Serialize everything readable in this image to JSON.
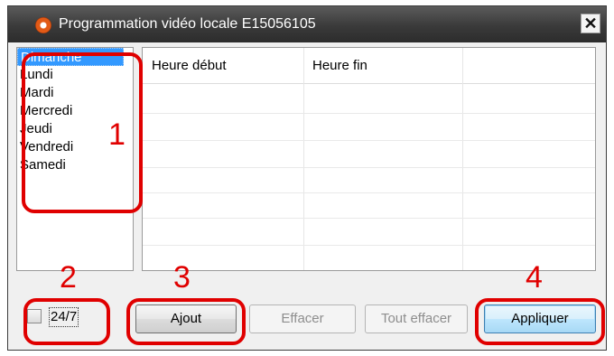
{
  "window": {
    "title": "Programmation vidéo locale E15056105",
    "close_glyph": "✕"
  },
  "days": [
    {
      "label": "Dimanche",
      "selected": true
    },
    {
      "label": "Lundi",
      "selected": false
    },
    {
      "label": "Mardi",
      "selected": false
    },
    {
      "label": "Mercredi",
      "selected": false
    },
    {
      "label": "Jeudi",
      "selected": false
    },
    {
      "label": "Vendredi",
      "selected": false
    },
    {
      "label": "Samedi",
      "selected": false
    }
  ],
  "table": {
    "columns": [
      "Heure début",
      "Heure fin",
      ""
    ],
    "rows": []
  },
  "options": {
    "full_time_label": "24/7",
    "full_time_checked": false
  },
  "buttons": {
    "add": "Ajout",
    "delete": "Effacer",
    "delete_all": "Tout effacer",
    "apply": "Appliquer"
  },
  "annotations": {
    "n1": "1",
    "n2": "2",
    "n3": "3",
    "n4": "4",
    "color": "#e00000"
  },
  "icons": {
    "app": "app-logo-icon",
    "close": "close-icon",
    "checkbox": "checkbox-icon"
  }
}
